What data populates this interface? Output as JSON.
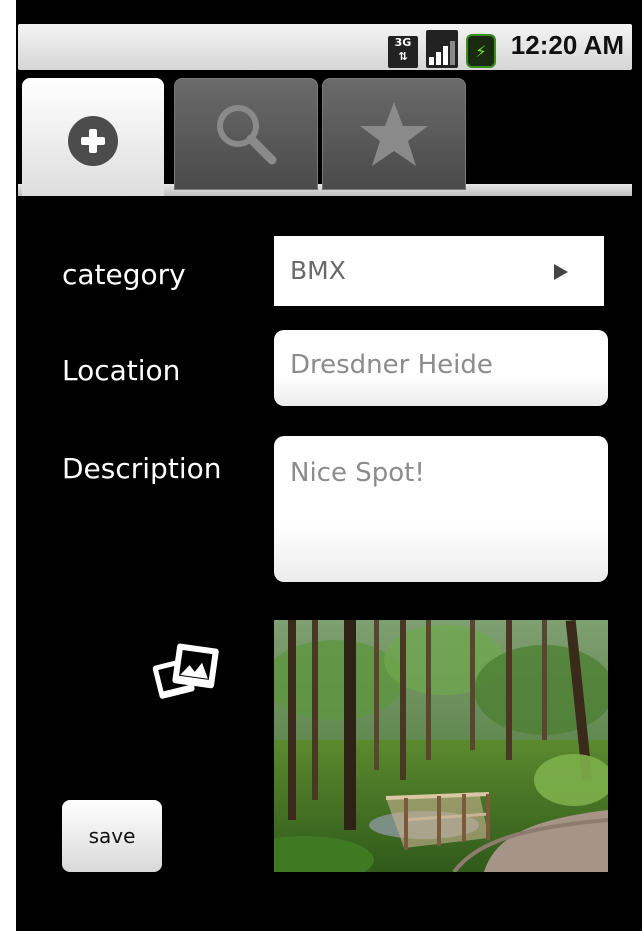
{
  "status_bar": {
    "network_badge": "3G",
    "time": "12:20 AM",
    "icons": [
      "network-3g-icon",
      "signal-strength-icon",
      "battery-charging-icon"
    ]
  },
  "tabs": [
    {
      "id": "add",
      "icon": "plus-circle-icon",
      "active": true
    },
    {
      "id": "search",
      "icon": "magnifier-icon",
      "active": false
    },
    {
      "id": "favorites",
      "icon": "star-icon",
      "active": false
    }
  ],
  "form": {
    "category_label": "category",
    "category_value": "BMX",
    "location_label": "Location",
    "location_value": "Dresdner Heide",
    "description_label": "Description",
    "description_value": "Nice Spot!",
    "photo_icon": "photo-gallery-icon",
    "save_label": "save"
  },
  "colors": {
    "background": "#000000",
    "label_text": "#ffffff",
    "input_text": "#8c8c8c"
  }
}
